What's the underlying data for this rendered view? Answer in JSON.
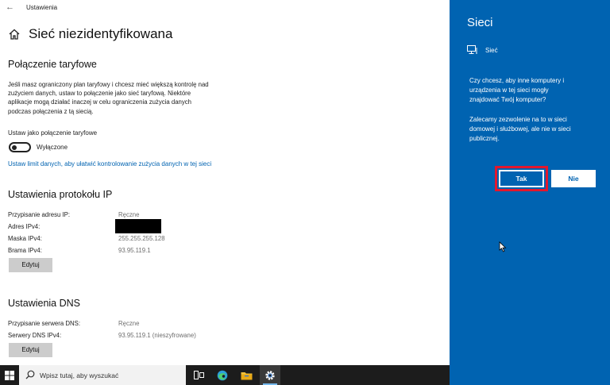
{
  "window": {
    "title": "Ustawienia"
  },
  "page": {
    "title": "Sieć niezidentyfikowana"
  },
  "metered": {
    "heading": "Połączenie taryfowe",
    "description_lines": [
      "Jeśli masz ograniczony plan taryfowy i chcesz mieć większą kontrolę nad",
      "zużyciem danych, ustaw to połączenie jako sieć taryfową. Niektóre",
      "aplikacje mogą działać inaczej w celu ograniczenia zużycia danych",
      "podczas połączenia z tą siecią."
    ],
    "toggle_label": "Ustaw jako połączenie taryfowe",
    "toggle_state": "Wyłączone",
    "toggle_on": false,
    "data_limit_link": "Ustaw limit danych, aby ułatwić kontrolowanie zużycia danych w tej sieci"
  },
  "ip": {
    "heading": "Ustawienia protokołu IP",
    "rows": [
      {
        "label": "Przypisanie adresu IP:",
        "value": "Ręczne"
      },
      {
        "label": "Adres IPv4:",
        "value": ""
      },
      {
        "label": "Maska IPv4:",
        "value": "255.255.255.128"
      },
      {
        "label": "Brama IPv4:",
        "value": "93.95.119.1"
      }
    ],
    "edit_button": "Edytuj"
  },
  "dns": {
    "heading": "Ustawienia DNS",
    "rows": [
      {
        "label": "Przypisanie serwera DNS:",
        "value": "Ręczne"
      },
      {
        "label": "Serwery DNS IPv4:",
        "value": "93.95.119.1 (nieszyfrowane)"
      }
    ],
    "edit_button": "Edytuj"
  },
  "flyout": {
    "title": "Sieci",
    "network_name": "Sieć",
    "question_lines": [
      "Czy chcesz, aby inne komputery i",
      "urządzenia w tej sieci mogły",
      "znajdować Twój komputer?"
    ],
    "recommendation_lines": [
      "Zalecamy zezwolenie na to w sieci",
      "domowej i służbowej, ale nie w sieci",
      "publicznej."
    ],
    "yes_button": "Tak",
    "no_button": "Nie"
  },
  "taskbar": {
    "search_placeholder": "Wpisz tutaj, aby wyszukać"
  },
  "colors": {
    "flyout_bg": "#0063b1",
    "highlight": "#e3172d",
    "link": "#0063b1",
    "taskbar_bg": "#1c1c1c"
  }
}
